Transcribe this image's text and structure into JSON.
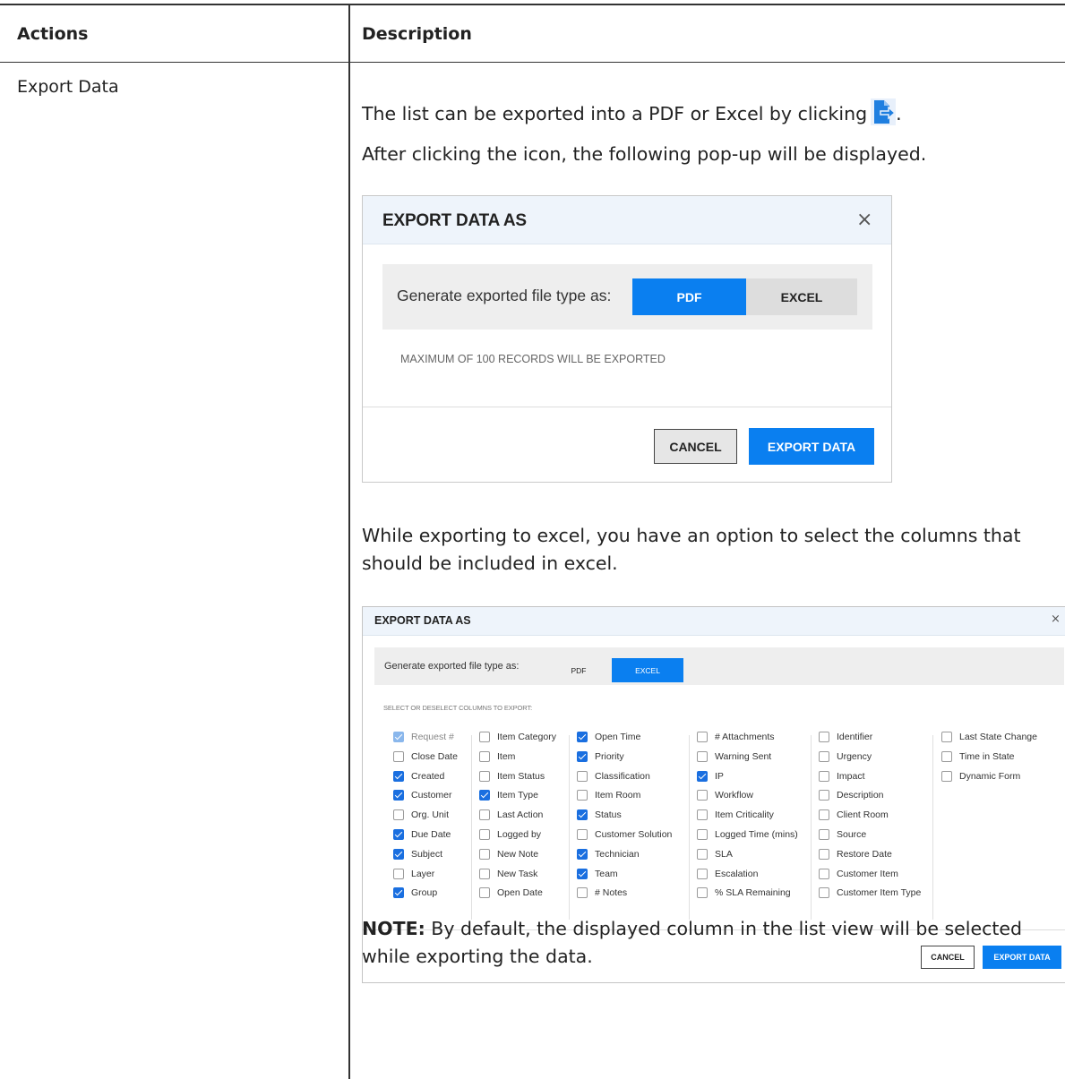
{
  "table": {
    "headers": {
      "actions": "Actions",
      "description": "Description"
    },
    "row": {
      "action": "Export Data",
      "p1": "The list can be exported into a PDF or Excel by clicking",
      "p1_end": ".",
      "p2": "After clicking the icon, the following pop-up will be displayed.",
      "p3": "While exporting to excel, you have an option to select the columns that should be included in excel.",
      "note_label": "NOTE:",
      "note_text": " By default, the displayed column in the list view will be selected while exporting the data."
    }
  },
  "icons": {
    "export": "export-file-icon",
    "close": "close-icon",
    "checkbox": "checkbox-icon"
  },
  "dialog_pdf": {
    "title": "EXPORT DATA AS",
    "close": "×",
    "generate_label": "Generate exported file type as:",
    "pdf": "PDF",
    "excel": "EXCEL",
    "selected": "PDF",
    "max_note": "MAXIMUM OF 100 RECORDS WILL BE EXPORTED",
    "cancel": "CANCEL",
    "export": "EXPORT DATA"
  },
  "dialog_excel": {
    "title": "EXPORT DATA AS",
    "close": "×",
    "generate_label": "Generate exported file type as:",
    "pdf": "PDF",
    "excel": "EXCEL",
    "selected": "EXCEL",
    "select_label": "SELECT OR DESELECT COLUMNS TO EXPORT:",
    "cancel": "CANCEL",
    "export": "EXPORT DATA",
    "columns": [
      [
        {
          "label": "Request #",
          "checked": true,
          "disabled": true
        },
        {
          "label": "Close Date",
          "checked": false
        },
        {
          "label": "Created",
          "checked": true
        },
        {
          "label": "Customer",
          "checked": true
        },
        {
          "label": "Org. Unit",
          "checked": false
        },
        {
          "label": "Due Date",
          "checked": true
        },
        {
          "label": "Subject",
          "checked": true
        },
        {
          "label": "Layer",
          "checked": false
        },
        {
          "label": "Group",
          "checked": true
        }
      ],
      [
        {
          "label": "Item Category",
          "checked": false
        },
        {
          "label": "Item",
          "checked": false
        },
        {
          "label": "Item Status",
          "checked": false
        },
        {
          "label": "Item Type",
          "checked": true
        },
        {
          "label": "Last Action",
          "checked": false
        },
        {
          "label": "Logged by",
          "checked": false
        },
        {
          "label": "New Note",
          "checked": false
        },
        {
          "label": "New Task",
          "checked": false
        },
        {
          "label": "Open Date",
          "checked": false
        }
      ],
      [
        {
          "label": "Open Time",
          "checked": true
        },
        {
          "label": "Priority",
          "checked": true
        },
        {
          "label": "Classification",
          "checked": false
        },
        {
          "label": "Item Room",
          "checked": false
        },
        {
          "label": "Status",
          "checked": true
        },
        {
          "label": "Customer Solution",
          "checked": false
        },
        {
          "label": "Technician",
          "checked": true
        },
        {
          "label": "Team",
          "checked": true
        },
        {
          "label": "# Notes",
          "checked": false
        }
      ],
      [
        {
          "label": "# Attachments",
          "checked": false
        },
        {
          "label": "Warning Sent",
          "checked": false
        },
        {
          "label": "IP",
          "checked": true
        },
        {
          "label": "Workflow",
          "checked": false
        },
        {
          "label": "Item Criticality",
          "checked": false
        },
        {
          "label": "Logged Time (mins)",
          "checked": false
        },
        {
          "label": "SLA",
          "checked": false
        },
        {
          "label": "Escalation",
          "checked": false
        },
        {
          "label": "% SLA Remaining",
          "checked": false
        }
      ],
      [
        {
          "label": "Identifier",
          "checked": false
        },
        {
          "label": "Urgency",
          "checked": false
        },
        {
          "label": "Impact",
          "checked": false
        },
        {
          "label": "Description",
          "checked": false
        },
        {
          "label": "Client Room",
          "checked": false
        },
        {
          "label": "Source",
          "checked": false
        },
        {
          "label": "Restore Date",
          "checked": false
        },
        {
          "label": "Customer Item",
          "checked": false
        },
        {
          "label": "Customer Item Type",
          "checked": false
        }
      ],
      [
        {
          "label": "Last State Change",
          "checked": false
        },
        {
          "label": "Time in State",
          "checked": false
        },
        {
          "label": "Dynamic Form",
          "checked": false
        }
      ]
    ]
  }
}
